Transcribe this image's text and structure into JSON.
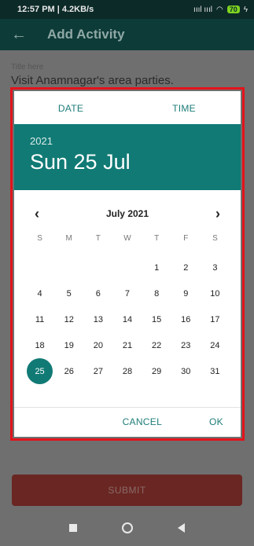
{
  "status_bar": {
    "time": "12:57 PM | 4.2KB/s",
    "signal": "ıııl ıııl",
    "battery": "70"
  },
  "app_bar": {
    "title": "Add Activity"
  },
  "form": {
    "title_label": "Title here",
    "title_value": "Visit Anamnagar's area parties.",
    "submit_label": "SUBMIT"
  },
  "dialog": {
    "tabs": {
      "date": "DATE",
      "time": "TIME"
    },
    "header": {
      "year": "2021",
      "date": "Sun 25 Jul"
    },
    "month_label": "July 2021",
    "weekdays": [
      "S",
      "M",
      "T",
      "W",
      "T",
      "F",
      "S"
    ],
    "blank_leading_days": 4,
    "days": [
      "1",
      "2",
      "3",
      "4",
      "5",
      "6",
      "7",
      "8",
      "9",
      "10",
      "11",
      "12",
      "13",
      "14",
      "15",
      "16",
      "17",
      "18",
      "19",
      "20",
      "21",
      "22",
      "23",
      "24",
      "25",
      "26",
      "27",
      "28",
      "29",
      "30",
      "31"
    ],
    "selected_day": "25",
    "cancel_label": "CANCEL",
    "ok_label": "OK"
  },
  "colors": {
    "accent": "#117a75",
    "highlight_frame": "#e3141b"
  }
}
